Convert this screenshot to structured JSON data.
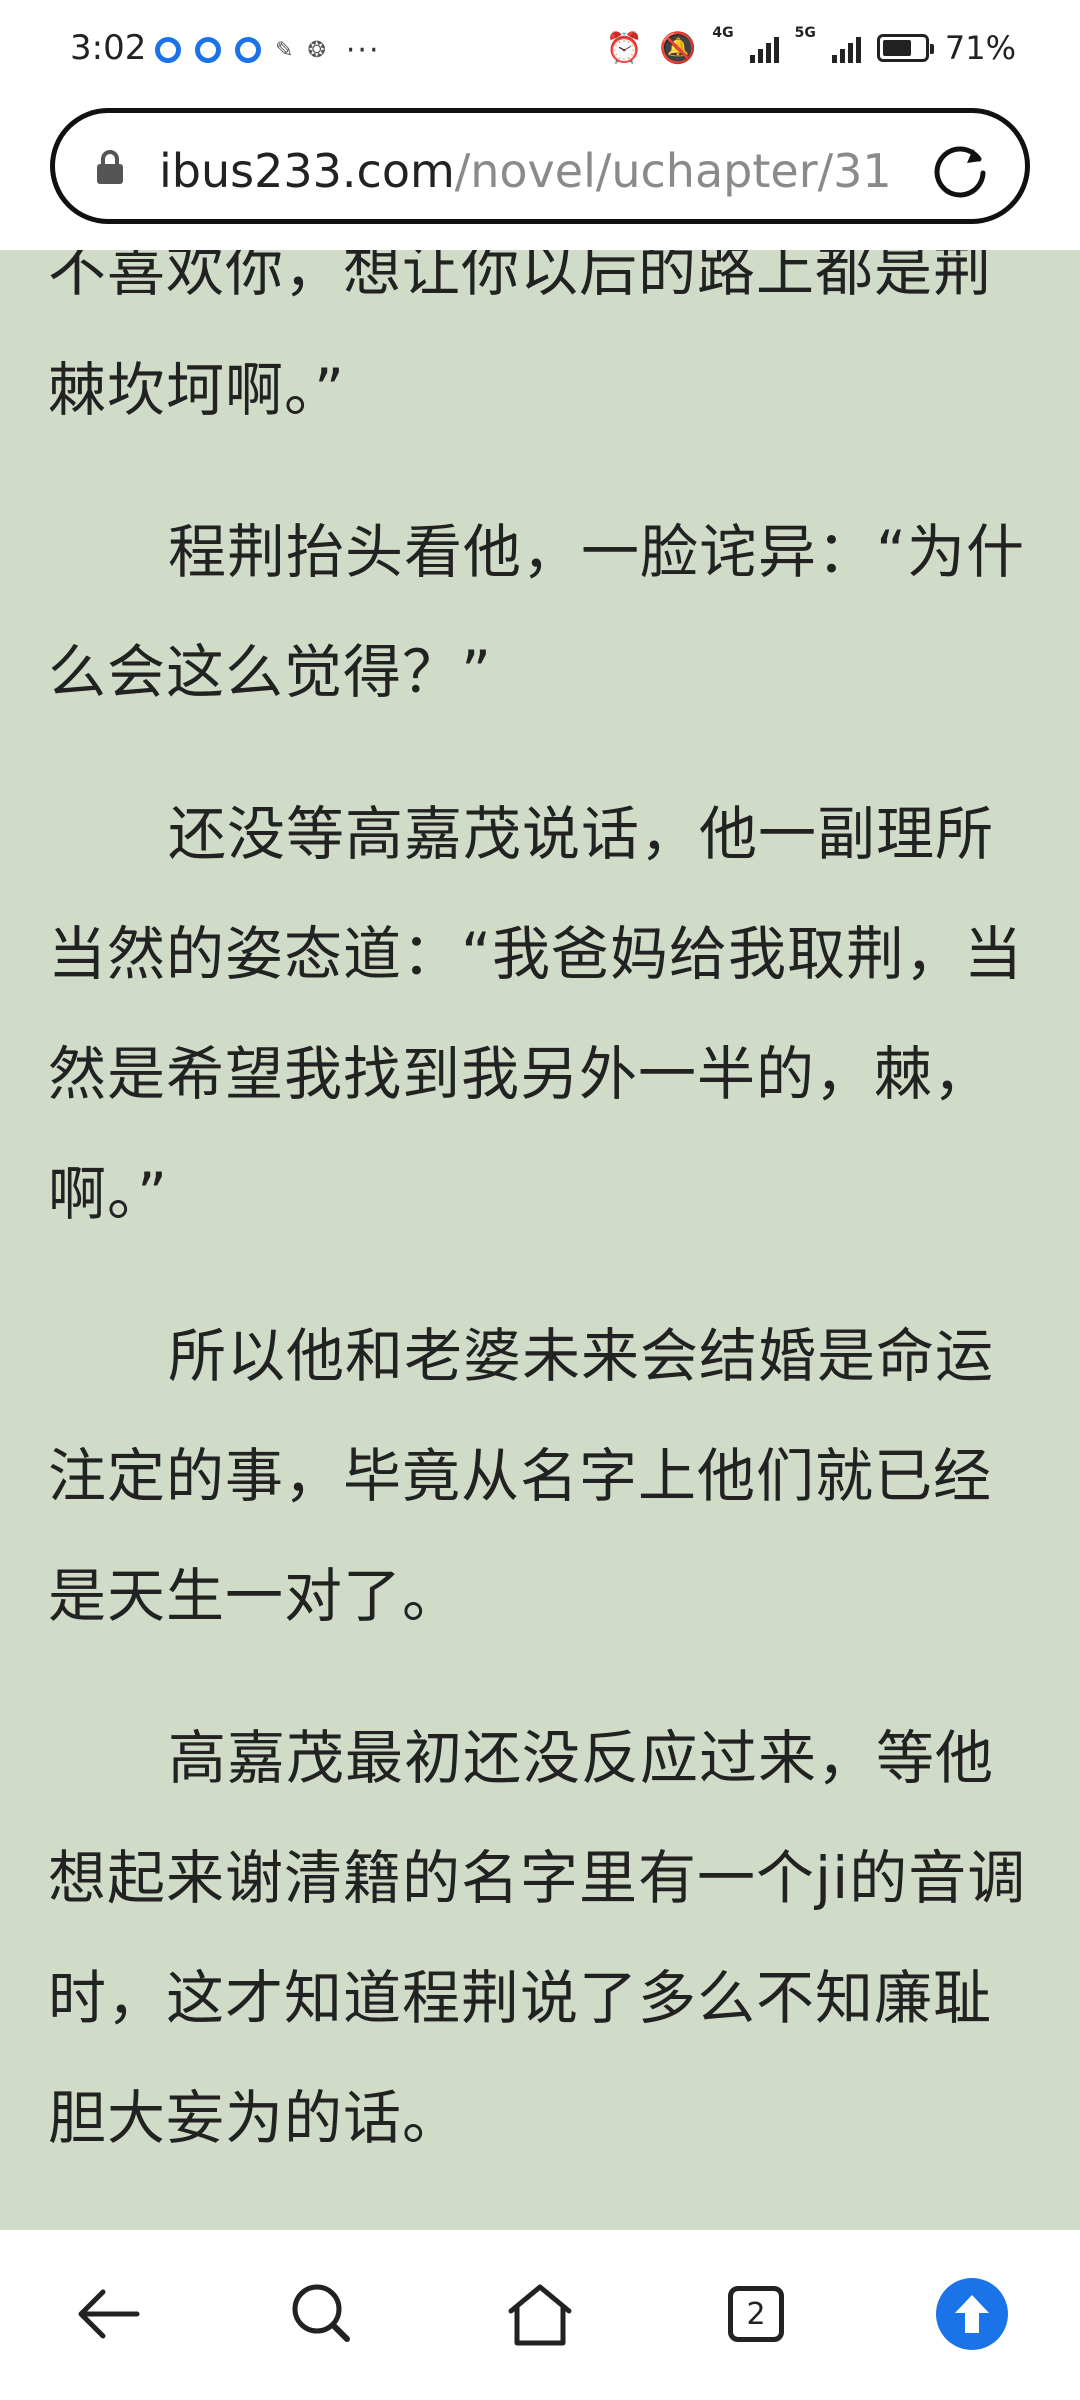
{
  "status_bar": {
    "time": "3:02",
    "more": "···",
    "network_4g": "4G",
    "network_5g": "5G",
    "battery_text": "71%",
    "battery_level": 0.71
  },
  "address_bar": {
    "url_host": "ibus233.com",
    "url_path": "/novel/uchapter/31"
  },
  "content": {
    "paragraphs": [
      "不喜欢你，想让你以后的路上都是荆棘坎坷啊。”",
      "程荆抬头看他，一脸诧异：“为什么会这么觉得？”",
      "还没等高嘉茂说话，他一副理所当然的姿态道：“我爸妈给我取荆，当然是希望我找到我另外一半的，棘，啊。”",
      "所以他和老婆未来会结婚是命运注定的事，毕竟从名字上他们就已经是天生一对了。",
      "高嘉茂最初还没反应过来，等他想起来谢清籍的名字里有一个ji的音调时，这才知道程荆说了多么不知廉耻胆大妄为的话。"
    ]
  },
  "bottom_nav": {
    "tab_count": "2",
    "accent_color": "#1a73e8"
  }
}
